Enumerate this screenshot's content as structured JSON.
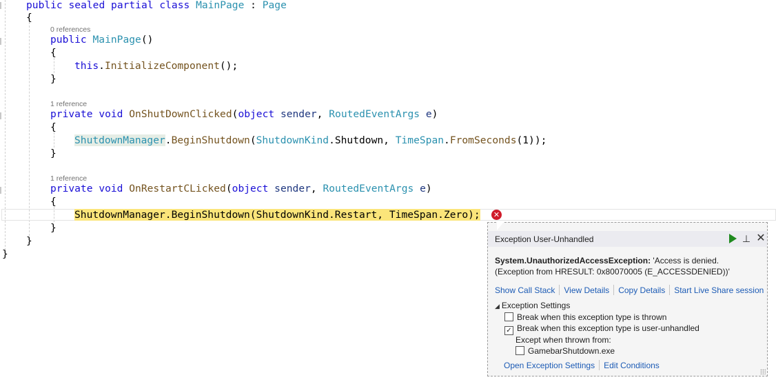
{
  "code": {
    "class_decl": {
      "kw1": "public",
      "kw2": "sealed",
      "kw3": "partial",
      "kw4": "class",
      "name": "MainPage",
      "colon": " : ",
      "base": "Page"
    },
    "open_brace": "{",
    "close_brace": "}",
    "ctor": {
      "lens": "0 references",
      "kw": "public",
      "name": "MainPage",
      "parens": "()",
      "body_this": "this",
      "body_dot": ".",
      "body_method": "InitializeComponent",
      "body_end": "();"
    },
    "shutdown_handler": {
      "lens": "1 reference",
      "kw1": "private",
      "kw2": "void",
      "name": "OnShutDownClicked",
      "open": "(",
      "p1type": "object",
      "p1name": "sender",
      "comma": ", ",
      "p2type": "RoutedEventArgs",
      "p2name": "e",
      "close": ")",
      "body": {
        "cls": "ShutdownManager",
        "dot1": ".",
        "method": "BeginShutdown",
        "open": "(",
        "enum": "ShutdownKind",
        "dot2": ".",
        "member": "Shutdown",
        "comma": ", ",
        "ts": "TimeSpan",
        "dot3": ".",
        "tsmethod": "FromSeconds",
        "args": "(1));"
      }
    },
    "restart_handler": {
      "lens": "1 reference",
      "kw1": "private",
      "kw2": "void",
      "name": "OnRestartCLicked",
      "open": "(",
      "p1type": "object",
      "p1name": "sender",
      "comma": ", ",
      "p2type": "RoutedEventArgs",
      "p2name": "e",
      "close": ")",
      "body": "ShutdownManager.BeginShutdown(ShutdownKind.Restart, TimeSpan.Zero);"
    }
  },
  "exception_popup": {
    "title": "Exception User-Unhandled",
    "continue_icon": "play-icon",
    "pin_icon": "pin-icon",
    "close_icon": "close-icon",
    "exception_type": "System.UnauthorizedAccessException:",
    "message": " 'Access is denied. (Exception from HRESULT: 0x80070005 (E_ACCESSDENIED))'",
    "links": [
      "Show Call Stack",
      "View Details",
      "Copy Details",
      "Start Live Share session"
    ],
    "settings_label": "Exception Settings",
    "options": [
      {
        "label": "Break when this exception type is thrown",
        "checked": false
      },
      {
        "label": "Break when this exception type is user-unhandled",
        "checked": true
      }
    ],
    "except_label": "Except when thrown from:",
    "module": {
      "label": "GamebarShutdown.exe",
      "checked": false
    },
    "bottom_links": [
      "Open Exception Settings",
      "Edit Conditions"
    ]
  },
  "colors": {
    "exec_highlight": "#fbe57a",
    "error": "#d01b2a",
    "link": "#1c5bb5",
    "keyword": "#0000ff",
    "type": "#2b91af"
  }
}
